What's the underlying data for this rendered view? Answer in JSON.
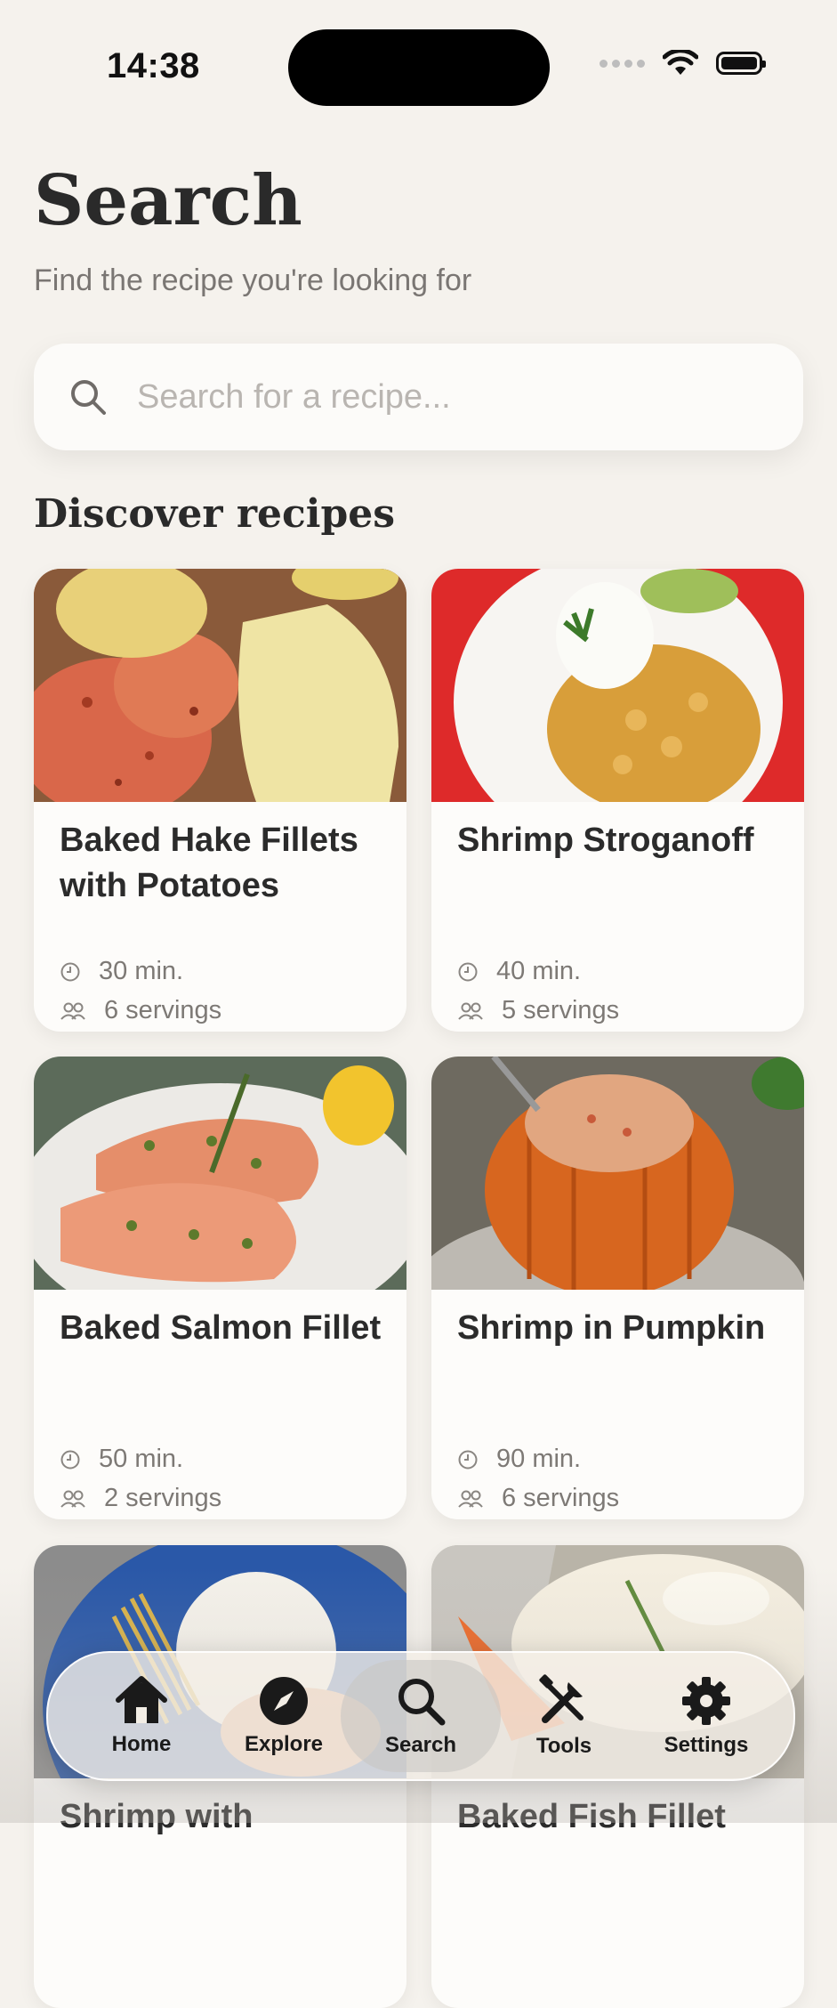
{
  "status_bar": {
    "time": "14:38"
  },
  "header": {
    "title": "Search",
    "subtitle": "Find the recipe you're looking for"
  },
  "search": {
    "placeholder": "Search for a recipe...",
    "value": ""
  },
  "discover": {
    "title": "Discover recipes",
    "recipes": [
      {
        "name": "Baked Hake Fillets with Potatoes",
        "time": "30 min.",
        "servings": "6 servings"
      },
      {
        "name": "Shrimp Stroganoff",
        "time": "40 min.",
        "servings": "5 servings"
      },
      {
        "name": "Baked Salmon Fillet",
        "time": "50 min.",
        "servings": "2 servings"
      },
      {
        "name": "Shrimp in Pumpkin",
        "time": "90 min.",
        "servings": "6 servings"
      },
      {
        "name": "Shrimp with",
        "time": "",
        "servings": ""
      },
      {
        "name": "Baked Fish Fillet",
        "time": "",
        "servings": ""
      }
    ]
  },
  "tabbar": {
    "items": [
      {
        "label": "Home",
        "icon": "home-icon"
      },
      {
        "label": "Explore",
        "icon": "compass-icon"
      },
      {
        "label": "Search",
        "icon": "search-icon",
        "active": true
      },
      {
        "label": "Tools",
        "icon": "tools-icon"
      },
      {
        "label": "Settings",
        "icon": "gear-icon"
      }
    ]
  },
  "colors": {
    "background": "#f5f2ed",
    "card": "#fdfcfa",
    "text": "#2b2b2b",
    "muted": "#7a7673"
  }
}
